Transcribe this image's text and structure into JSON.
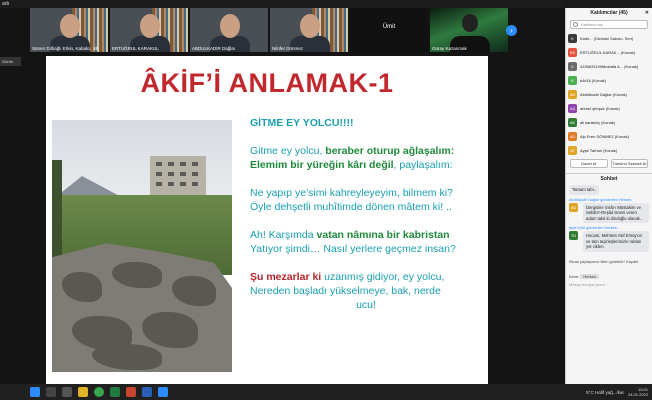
{
  "window": {
    "title": "arb",
    "view_label": "Görün"
  },
  "videos": [
    {
      "name": "Sümer Dilbağlı Erkin, Kabalcı, Sb",
      "style": "shelf"
    },
    {
      "name": "ERTUĞRUL KARAKUL",
      "style": "shelf"
    },
    {
      "name": "ABDULKADİR Dağlar",
      "style": "plain"
    },
    {
      "name": "Nilüfer Dönmez",
      "style": "shelf"
    },
    {
      "name": "Ümit",
      "style": "dark",
      "center": "Ümit"
    },
    {
      "name": "Güray Kazanmak",
      "style": "aurora"
    }
  ],
  "slide": {
    "title": "ÂKİF’İ ANLAMAK-1",
    "poem_heading": "GİTME EY YOLCU!!!!",
    "poem": [
      [
        {
          "t": "Gitme ey yolcu, ",
          "c": ""
        },
        {
          "t": "beraber oturup ağlaşalım:",
          "c": "green"
        }
      ],
      [
        {
          "t": "Elemim bir yüreğin kârı değil",
          "c": "green"
        },
        {
          "t": ", paylaşalım:",
          "c": ""
        }
      ],
      [],
      [
        {
          "t": "Ne yapıp ye’simi kahreyleyeyim, bilmem ki?",
          "c": ""
        }
      ],
      [
        {
          "t": "Öyle dehşetli muhîtimde dönen mâtem ki! ..",
          "c": ""
        }
      ],
      [],
      [
        {
          "t": "Ah! Karşımda ",
          "c": ""
        },
        {
          "t": "vatan nâmına bir kabristan",
          "c": "green"
        }
      ],
      [
        {
          "t": "Yatıyor şimdi… Nasıl yerlere geçmez insan?",
          "c": ""
        }
      ],
      [],
      [
        {
          "t": "Şu mezarlar ",
          "c": "red"
        },
        {
          "t": "ki",
          "c": "red"
        },
        {
          "t": " uzanmış gidiyor, ey yolcu,",
          "c": ""
        }
      ],
      [
        {
          "t": "Nereden başladı yükselmeye, bak, nerde",
          "c": ""
        }
      ],
      [
        {
          "t": "ucu!",
          "c": "center"
        }
      ]
    ]
  },
  "participants_panel": {
    "title": "Katılımcılar (45)",
    "search_placeholder": "Katılımcı bul",
    "items": [
      {
        "initials": "K",
        "name": "Kadir... (Olcinski Sabolu, Sen)",
        "color": "#3a3a3a"
      },
      {
        "initials": "EK",
        "name": "ERTUĞRUL KARAK...    (Konak)",
        "color": "#e5533d"
      },
      {
        "initials": "4",
        "name": "4335831199Mustafa A...  (Konak)",
        "color": "#6d6d6d"
      },
      {
        "initials": "K",
        "name": "k4d16 (Konak)",
        "color": "#4caf50"
      },
      {
        "initials": "AD",
        "name": "Abdülkadir Dağlar (Konak)",
        "color": "#e0a526"
      },
      {
        "initials": "AŞ",
        "name": "ahmet şimşek (Konak)",
        "color": "#8e44ad"
      },
      {
        "initials": "AK",
        "name": "ali karakılıç (Konak)",
        "color": "#2e7d32"
      },
      {
        "initials": "AD",
        "name": "Alp Eren DÖNMEZ (Konak)",
        "color": "#e07a26"
      },
      {
        "initials": "AT",
        "name": "Ayşe Tarhan (Konak)",
        "color": "#e0a526"
      }
    ],
    "buttons": {
      "invite": "Davet et",
      "mute_all": "Tümünü Sessize Al"
    }
  },
  "chat_panel": {
    "title": "Sohbet",
    "messages": [
      {
        "sender": "",
        "avatar": "",
        "text": "Tamam tabi.."
      },
      {
        "sender": "Abdülkadir Dağlar gönderilen Herkes:",
        "avatar": "AD",
        "avatar_color": "#e0a526",
        "text": "Dergisine Sırât-ı Müstakim ve Sebilü'r-Reşâd ismini veren adam tabii ki dindoğlu olacak.."
      },
      {
        "sender": "tayit Ünül gönderilen Herkes:",
        "avatar": "TÜ",
        "avatar_color": "#2e7d32",
        "text": "Hocam, Mehmet Akif Ersoy'un ve tam taçirleşlerimizin rublan yet ciklen."
      }
    ],
    "share_text": "Ekran paylaşımını bilen görebilir? Kaydet",
    "to_label": "Kime:",
    "to_value": "Herkes",
    "input_placeholder": "Mesajı buraya yazın..."
  },
  "taskbar": {
    "weather": "5°C  Hafif yağ.../kar",
    "time": "10:01",
    "date": "24.01.2022"
  }
}
